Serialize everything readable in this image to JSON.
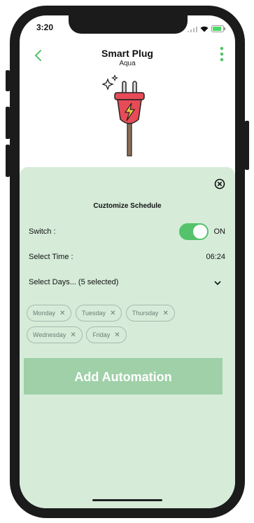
{
  "status_bar": {
    "time": "3:20"
  },
  "header": {
    "title": "Smart Plug",
    "subtitle": "Aqua"
  },
  "sheet": {
    "title": "Cuztomize Schedule",
    "switch": {
      "label": "Switch :",
      "state": "ON",
      "on": true
    },
    "time": {
      "label": "Select Time :",
      "value": "06:24"
    },
    "days": {
      "label": "Select Days... (5 selected)"
    },
    "selected_days": [
      "Monday",
      "Tuesday",
      "Thursday",
      "Wednesday",
      "Friday"
    ],
    "add_button_label": "Add Automation"
  },
  "colors": {
    "accent_green": "#55c36c",
    "sheet_bg": "#d6ecd9",
    "button_bg": "#9fd0a8",
    "plug_red": "#e74b57"
  }
}
